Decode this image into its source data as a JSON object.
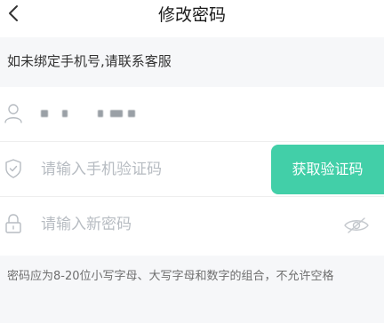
{
  "header": {
    "title": "修改密码",
    "back_icon": "chevron-left-icon"
  },
  "notice": {
    "text": "如未绑定手机号,请联系客服"
  },
  "form": {
    "phone": {
      "icon": "user-icon",
      "value": "obscured"
    },
    "code": {
      "icon": "shield-icon",
      "placeholder": "请输入手机验证码",
      "button_label": "获取验证码"
    },
    "password": {
      "icon": "lock-icon",
      "placeholder": "请输入新密码",
      "toggle_icon": "eye-closed-icon"
    }
  },
  "rules": {
    "text": "密码应为8-20位小写字母、大写字母和数字的组合，不允许空格"
  },
  "colors": {
    "accent": "#42cfa8",
    "background": "#f6f7f9",
    "placeholder": "#b7bcc2"
  }
}
